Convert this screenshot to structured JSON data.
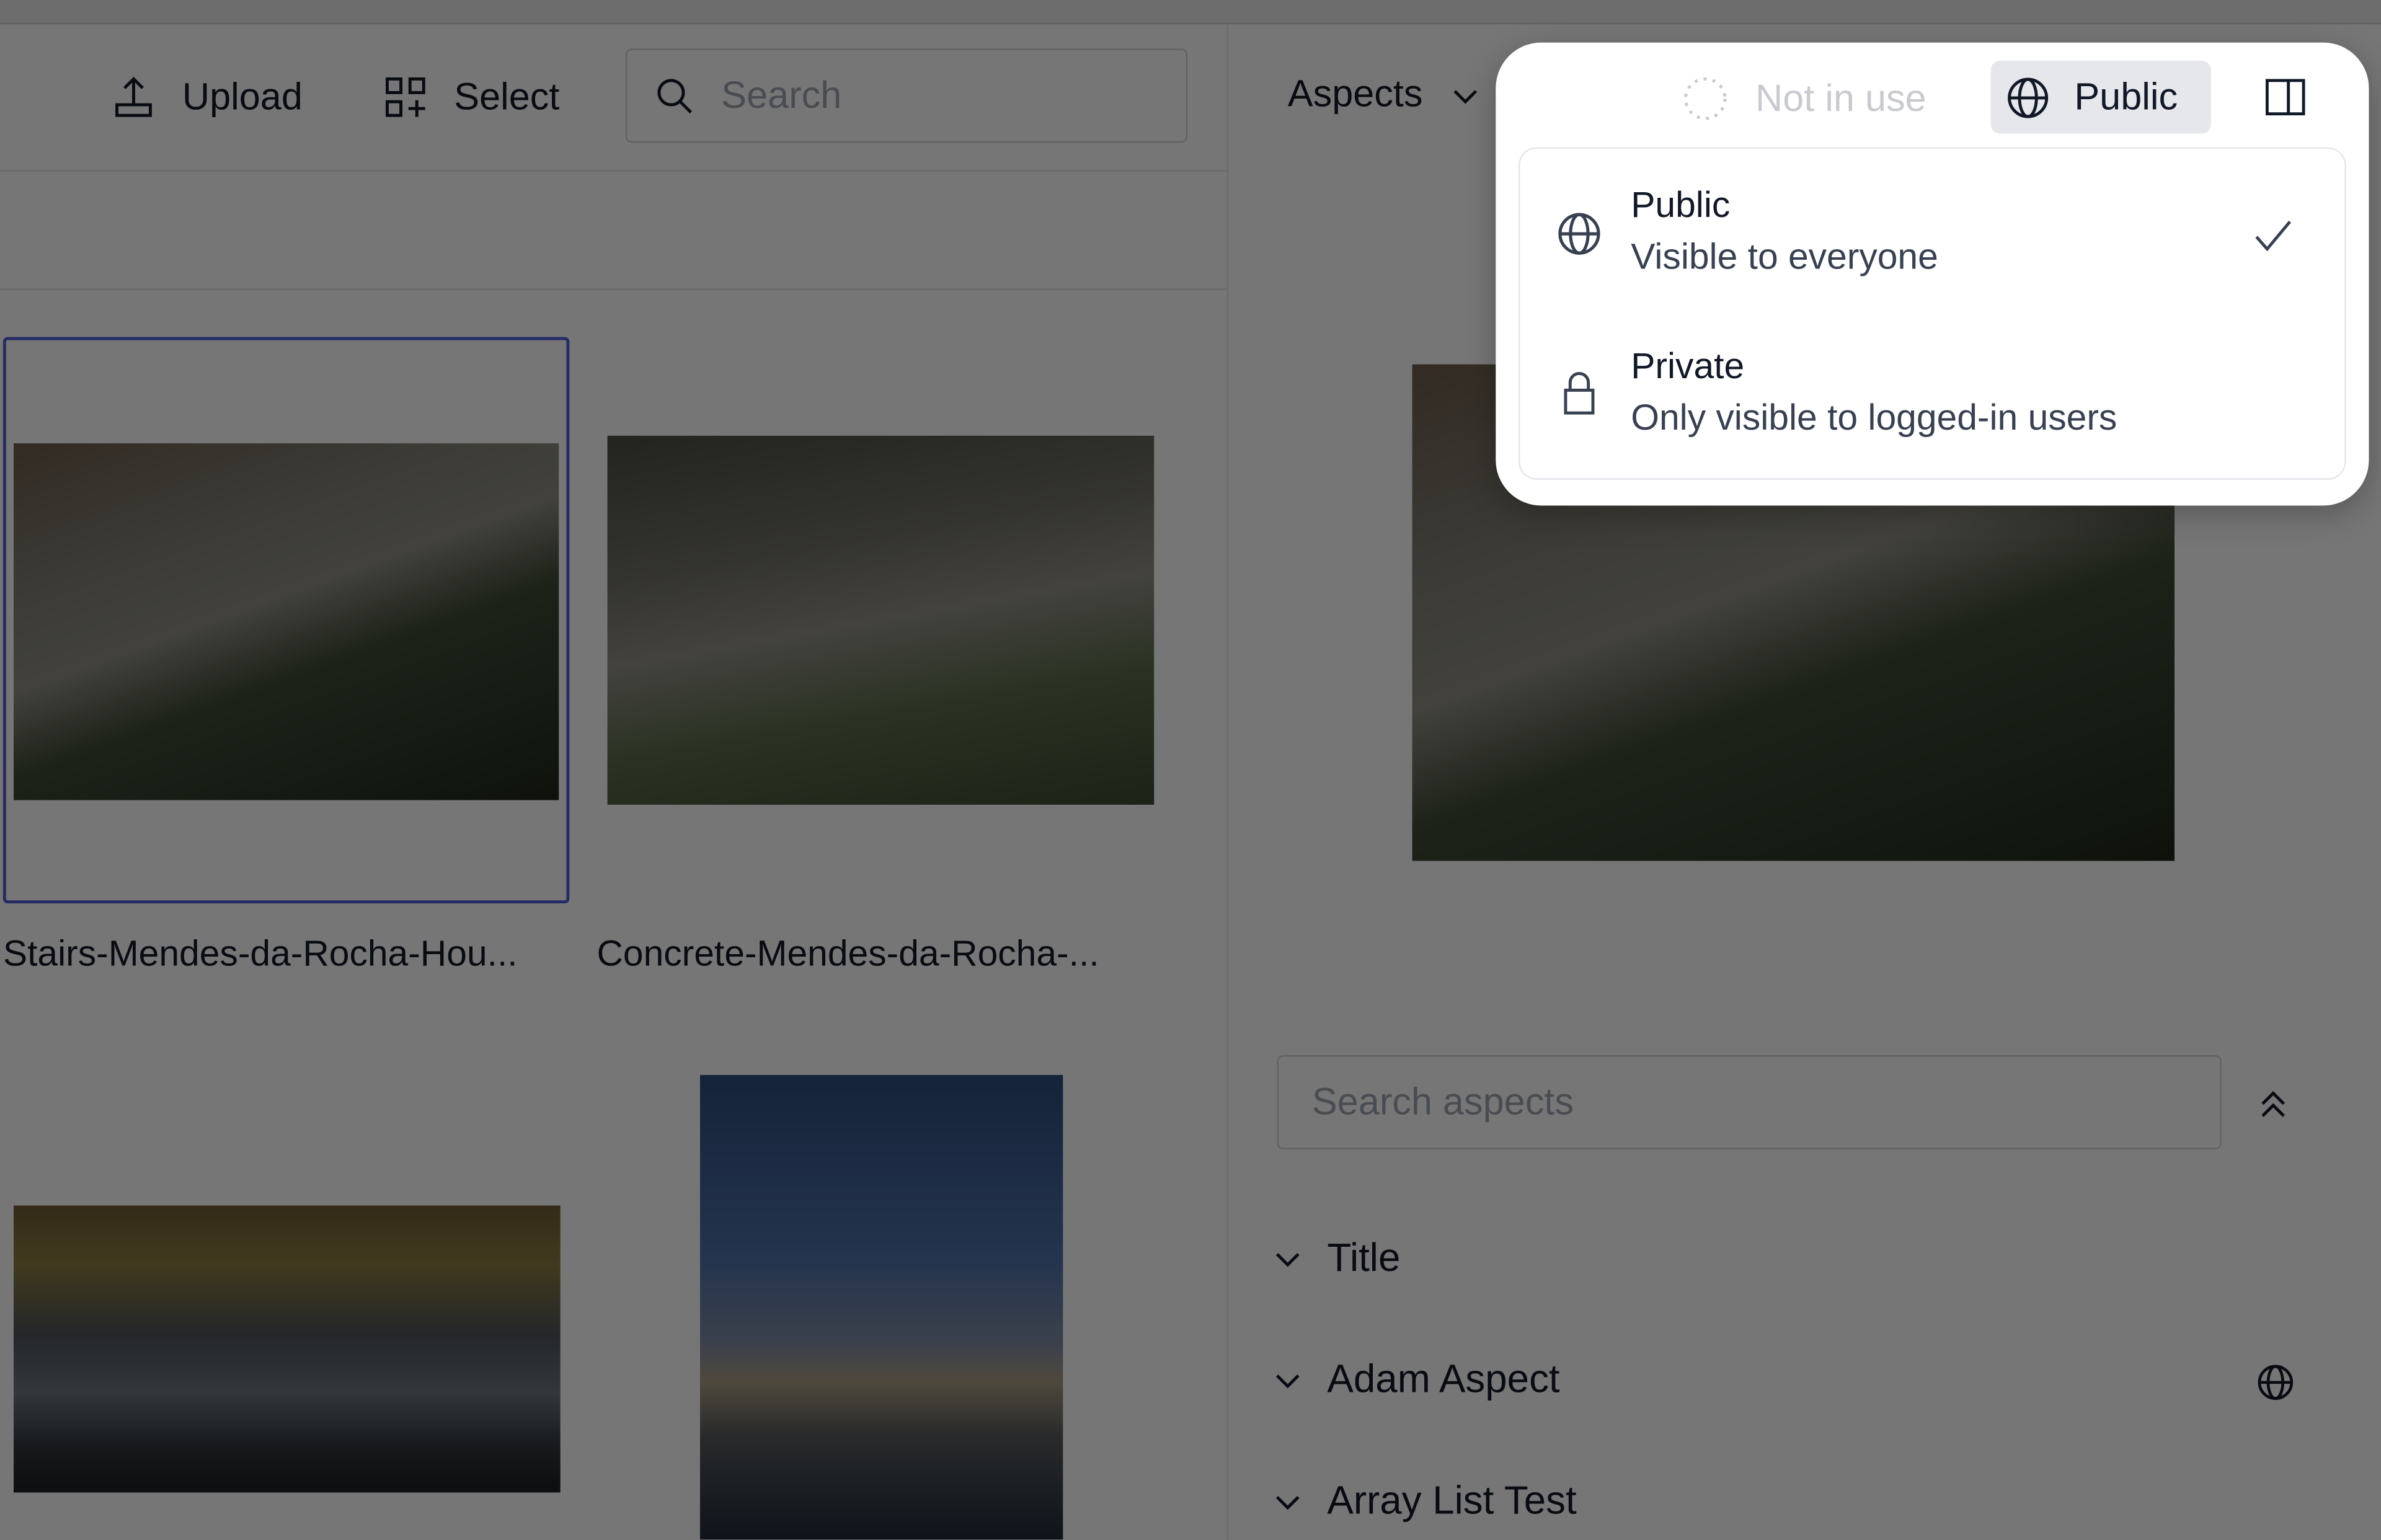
{
  "toolbar": {
    "upload_label": "Upload",
    "select_label": "Select",
    "search_placeholder": "Search"
  },
  "grid": {
    "items": [
      {
        "label": "Stairs-Mendes-da-Rocha-Hou...",
        "selected": true
      },
      {
        "label": "Concrete-Mendes-da-Rocha-...",
        "selected": false
      },
      {
        "label": "",
        "selected": false
      },
      {
        "label": "",
        "selected": false
      }
    ]
  },
  "right_panel": {
    "aspects_label": "Aspects",
    "search_aspects_placeholder": "Search aspects",
    "aspects": [
      {
        "label": "Title"
      },
      {
        "label": "Adam Aspect",
        "icon": "globe-icon"
      },
      {
        "label": "Array List Test"
      }
    ]
  },
  "popover": {
    "status_label": "Not in use",
    "visibility_label": "Public",
    "options": [
      {
        "title": "Public",
        "subtitle": "Visible to everyone",
        "icon": "globe-icon",
        "selected": true
      },
      {
        "title": "Private",
        "subtitle": "Only visible to logged-in users",
        "icon": "lock-icon",
        "selected": false
      }
    ]
  },
  "colors": {
    "selection_border": "#4f5fd8",
    "overlay": "rgba(0,0,0,0.535)",
    "active_button_bg": "#e5e7eb"
  }
}
